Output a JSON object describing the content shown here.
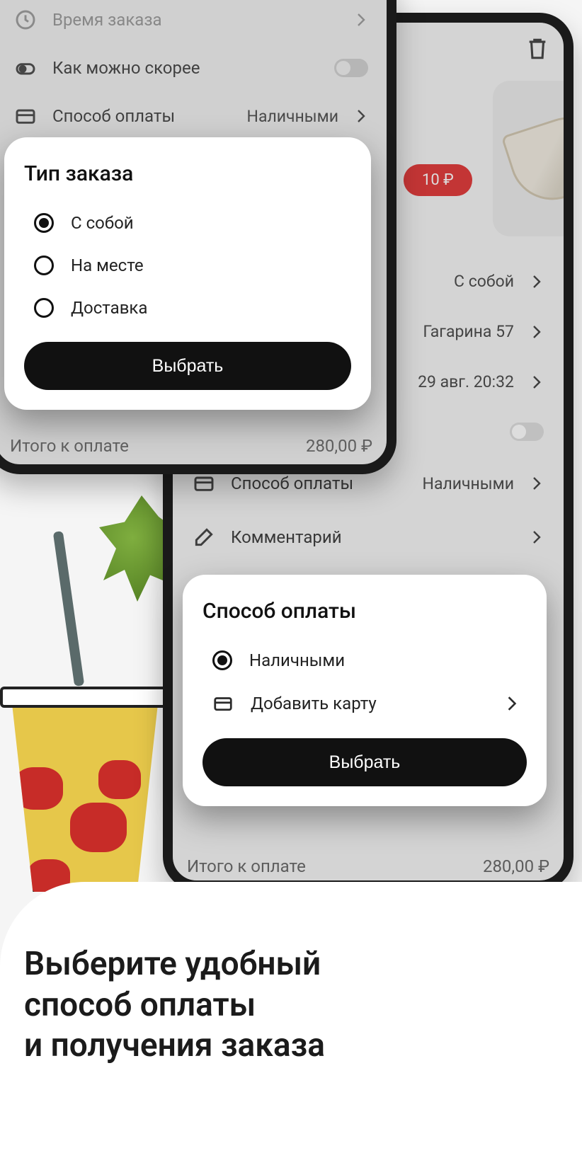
{
  "phone1": {
    "asap_label": "Как можно скорее",
    "payment_label": "Способ оплаты",
    "payment_value": "Наличными",
    "total_label": "Итого к оплате",
    "total_value": "280,00 ₽"
  },
  "dialog1": {
    "title": "Тип заказа",
    "options": [
      "С собой",
      "На месте",
      "Доставка"
    ],
    "selected": 0,
    "button": "Выбрать"
  },
  "phone2": {
    "price_badge": "10 ₽",
    "rows": {
      "type_value": "С собой",
      "address_value": "Гагарина 57",
      "time_value": "29 авг. 20:32",
      "payment_label": "Способ оплаты",
      "payment_value": "Наличными",
      "comment_label": "Комментарий"
    },
    "total_label": "Итого к оплате",
    "total_value": "280,00 ₽"
  },
  "dialog2": {
    "title": "Способ оплаты",
    "cash_label": "Наличными",
    "add_card_label": "Добавить карту",
    "button": "Выбрать"
  },
  "promo": {
    "line1": "Выберите удобный",
    "line2": "способ оплаты",
    "line3": "и получения заказа"
  }
}
